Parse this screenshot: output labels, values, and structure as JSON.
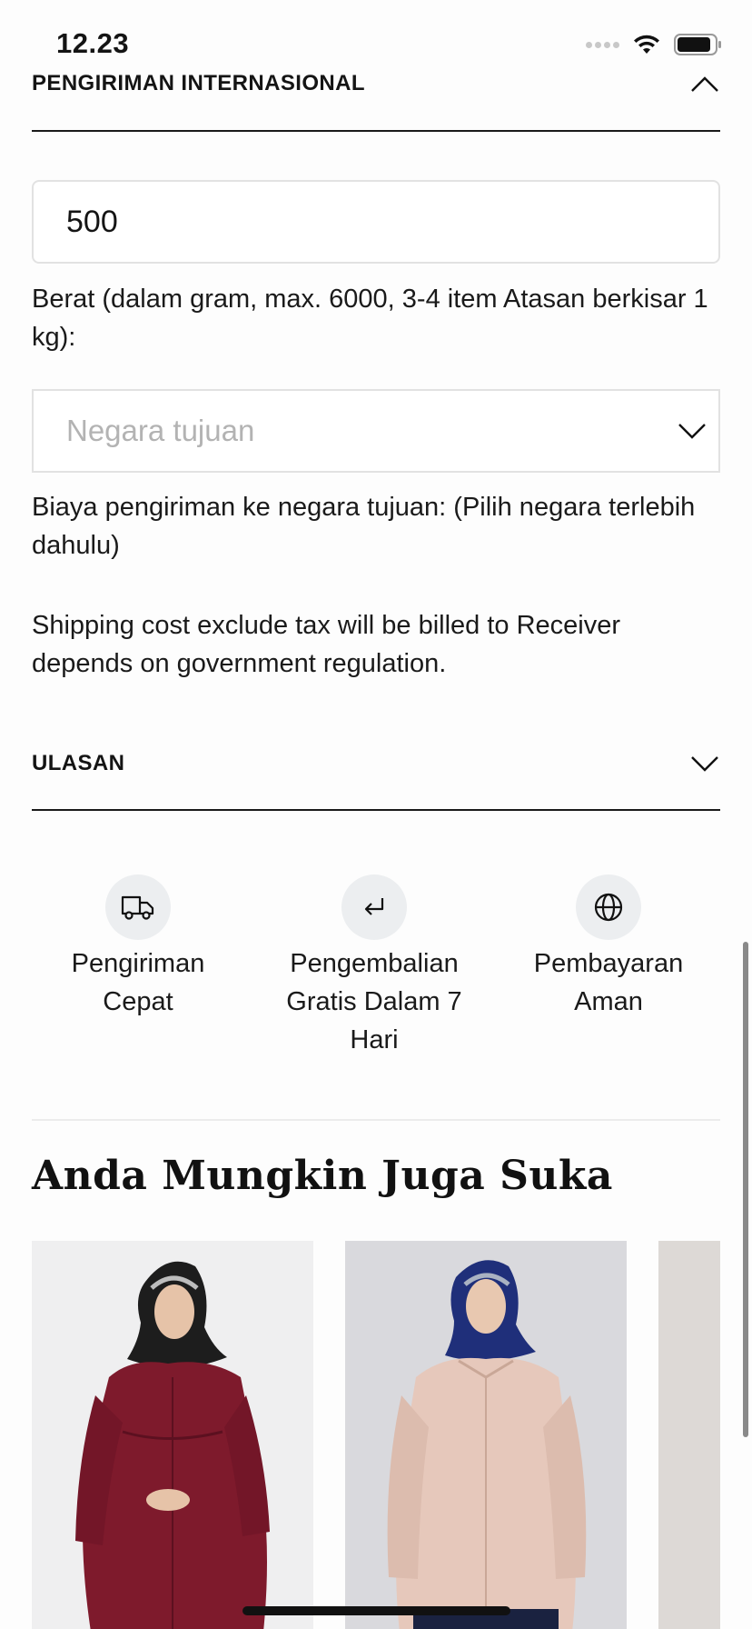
{
  "status_bar": {
    "time": "12.23",
    "icons": [
      "signal-dots-icon",
      "wifi-icon",
      "battery-icon"
    ]
  },
  "shipping": {
    "title": "PENGIRIMAN INTERNASIONAL",
    "expanded": true,
    "weight_value": "500",
    "weight_label": "Berat (dalam gram, max. 6000, 3-4 item Atasan berkisar 1 kg):",
    "country_placeholder": "Negara tujuan",
    "cost_text": "Biaya pengiriman ke negara tujuan: (Pilih negara terlebih dahulu)",
    "tax_note": "Shipping cost exclude tax will be billed to Receiver depends on government regulation."
  },
  "reviews": {
    "title": "ULASAN",
    "expanded": false
  },
  "features": [
    {
      "icon": "truck-icon",
      "label": "Pengiriman Cepat"
    },
    {
      "icon": "return-arrow-icon",
      "label": "Pengembalian Gratis Dalam 7 Hari"
    },
    {
      "icon": "globe-icon",
      "label": "Pembayaran Aman"
    }
  ],
  "recommendations": {
    "title": "Anda Mungkin Juga Suka",
    "products": [
      {
        "image": "model in maroon ruffled blouse and black hijab"
      },
      {
        "image": "model in pale pink collared shirt and navy hijab"
      },
      {
        "image": "partially visible product card"
      }
    ]
  },
  "colors": {
    "text": "#141414",
    "divider": "#1a1a1a",
    "input_border": "#e2e2e2",
    "icon_bg": "#eceef0",
    "maroon": "#7e1a2c",
    "pink": "#e6c8bb",
    "navy": "#1f2f7a"
  }
}
